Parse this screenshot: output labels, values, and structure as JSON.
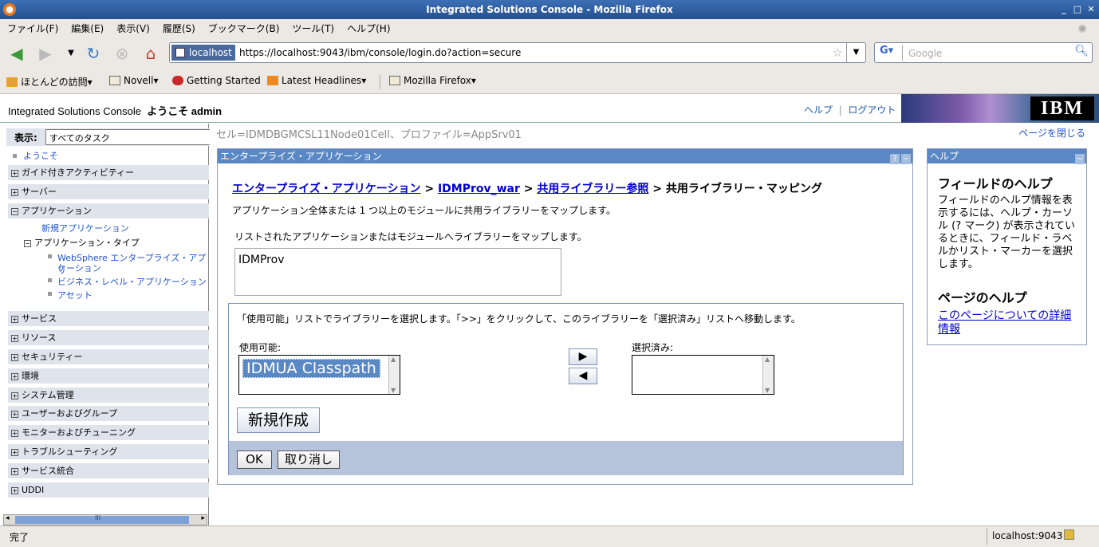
{
  "window": {
    "title": "Integrated Solutions Console - Mozilla Firefox"
  },
  "menu": [
    "ファイル(F)",
    "編集(E)",
    "表示(V)",
    "履歴(S)",
    "ブックマーク(B)",
    "ツール(T)",
    "ヘルプ(H)"
  ],
  "nav": {
    "host": "localhost",
    "url": "https://localhost:9043/ibm/console/login.do?action=secure",
    "search_placeholder": "Google"
  },
  "bookmarks": [
    "ほとんどの訪問",
    "Novell",
    "Getting Started",
    "Latest Headlines",
    "Mozilla Firefox"
  ],
  "console": {
    "title": "Integrated Solutions Console",
    "welcome": "ようこそ admin",
    "help": "ヘルプ",
    "sep": "|",
    "logout": "ログアウト",
    "logo": "IBM"
  },
  "leftnav": {
    "view_label": "表示:",
    "view_value": "すべてのタスク",
    "welcome": "ようこそ",
    "items_top": [
      "ガイド付きアクティビティー",
      "サーバー",
      "アプリケーション"
    ],
    "app_children": {
      "new_app": "新規アプリケーション",
      "app_types": "アプリケーション・タイプ",
      "websphere1": "WebSphere エンタープライズ・アプリ",
      "websphere2": "ケーション",
      "bla": "ビジネス・レベル・アプリケーション",
      "assets": "アセット"
    },
    "items_bottom": [
      "サービス",
      "リソース",
      "セキュリティー",
      "環境",
      "システム管理",
      "ユーザーおよびグループ",
      "モニターおよびチューニング",
      "トラブルシューティング",
      "サービス統合",
      "UDDI"
    ],
    "scroll_grip": "III"
  },
  "content": {
    "cell": "セル=IDMDBGMCSL11Node01Cell、プロファイル=AppSrv01",
    "close_page": "ページを閉じる",
    "panel_title": "エンタープライズ・アプリケーション",
    "breadcrumb": {
      "l1": "エンタープライズ・アプリケーション",
      "l2": "IDMProv_war",
      "l3": "共用ライブラリー参照",
      "sep": ">",
      "current": "共用ライブラリー・マッピング"
    },
    "desc1": "アプリケーション全体または 1 つ以上のモジュールに共用ライブラリーをマップします。",
    "desc2": "リストされたアプリケーションまたはモジュールへライブラリーをマップします。",
    "module": "IDMProv",
    "instr": "「使用可能」リストでライブラリーを選択します。「>>」をクリックして、このライブラリーを「選択済み」リストへ移動します。",
    "available_label": "使用可能:",
    "available_items": [
      "IDMUA Classpath"
    ],
    "selected_label": "選択済み:",
    "new_button": "新規作成",
    "ok": "OK",
    "cancel": "取り消し"
  },
  "help": {
    "title": "ヘルプ",
    "field_h": "フィールドのヘルプ",
    "field_p": "フィールドのヘルプ情報を表示するには、ヘルプ・カーソル (? マーク) が表示されているときに、フィールド・ラベルかリスト・マーカーを選択します。",
    "page_h": "ページのヘルプ",
    "page_link": "このページについての詳細情報"
  },
  "status": {
    "text": "完了",
    "host": "localhost:9043"
  }
}
